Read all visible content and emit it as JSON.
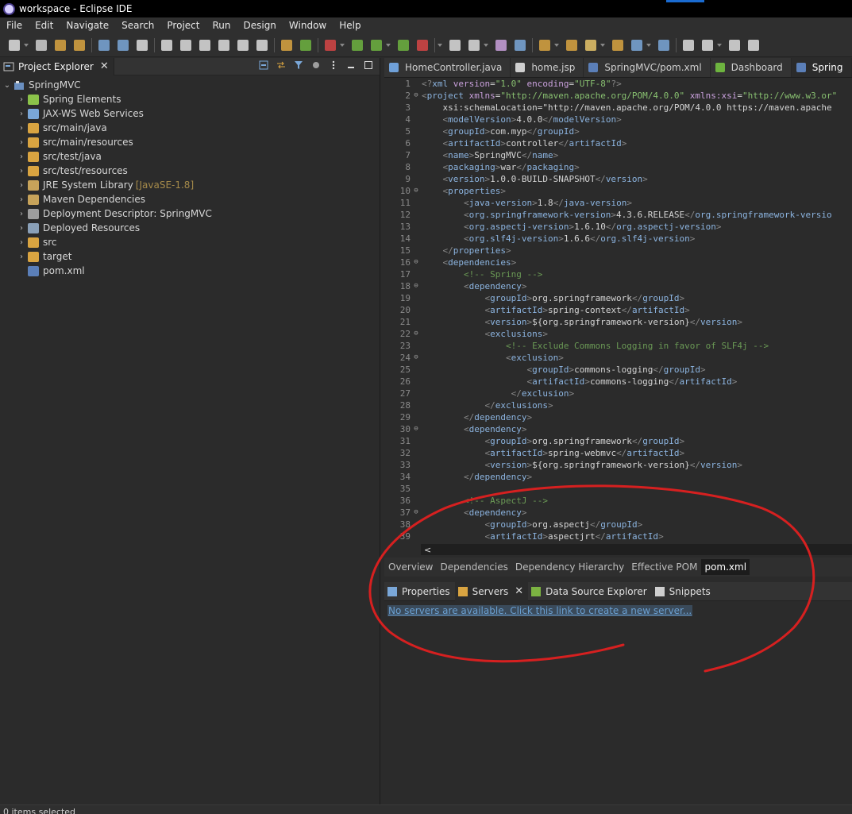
{
  "window": {
    "title": "workspace - Eclipse IDE"
  },
  "menu": [
    "File",
    "Edit",
    "Navigate",
    "Search",
    "Project",
    "Run",
    "Design",
    "Window",
    "Help"
  ],
  "project_explorer": {
    "title": "Project Explorer",
    "root": "SpringMVC",
    "items": [
      {
        "label": "Spring Elements",
        "icon": "spring-leaf-icon",
        "color": "#8bc34a"
      },
      {
        "label": "JAX-WS Web Services",
        "icon": "web-services-icon",
        "color": "#7aa7d8"
      },
      {
        "label": "src/main/java",
        "icon": "source-folder-icon",
        "color": "#d9a441"
      },
      {
        "label": "src/main/resources",
        "icon": "source-folder-icon",
        "color": "#d9a441"
      },
      {
        "label": "src/test/java",
        "icon": "source-folder-icon",
        "color": "#d9a441"
      },
      {
        "label": "src/test/resources",
        "icon": "source-folder-icon",
        "color": "#d9a441"
      },
      {
        "label": "JRE System Library",
        "decoration": "[JavaSE-1.8]",
        "icon": "library-icon",
        "color": "#c7a35a"
      },
      {
        "label": "Maven Dependencies",
        "icon": "library-icon",
        "color": "#c7a35a"
      },
      {
        "label": "Deployment Descriptor: SpringMVC",
        "icon": "descriptor-icon",
        "color": "#9e9e9e"
      },
      {
        "label": "Deployed Resources",
        "icon": "deployed-icon",
        "color": "#8aa0b8"
      },
      {
        "label": "src",
        "icon": "folder-icon",
        "color": "#d9a441"
      },
      {
        "label": "target",
        "icon": "folder-icon",
        "color": "#d9a441"
      },
      {
        "label": "pom.xml",
        "icon": "maven-file-icon",
        "color": "#5b7fb8",
        "leaf": true
      }
    ]
  },
  "editor": {
    "tabs": [
      {
        "label": "HomeController.java",
        "icon": "java-file-icon",
        "color": "#6fa0d8"
      },
      {
        "label": "home.jsp",
        "icon": "jsp-file-icon",
        "color": "#cfcfcf"
      },
      {
        "label": "SpringMVC/pom.xml",
        "icon": "maven-file-icon",
        "color": "#5b7fb8"
      },
      {
        "label": "Dashboard",
        "icon": "spring-dashboard-icon",
        "color": "#6db33f"
      },
      {
        "label": "Spring",
        "icon": "maven-file-icon",
        "color": "#5b7fb8",
        "active": true
      }
    ],
    "lines": [
      {
        "n": "1",
        "fold": "",
        "text": "<?xml version=\"1.0\" encoding=\"UTF-8\"?>"
      },
      {
        "n": "2",
        "fold": "⊖",
        "text": "<project xmlns=\"http://maven.apache.org/POM/4.0.0\" xmlns:xsi=\"http://www.w3.or"
      },
      {
        "n": "3",
        "fold": "",
        "text": "    xsi:schemaLocation=\"http://maven.apache.org/POM/4.0.0 https://maven.apache"
      },
      {
        "n": "4",
        "fold": "",
        "text": "    <modelVersion>4.0.0</modelVersion>"
      },
      {
        "n": "5",
        "fold": "",
        "text": "    <groupId>com.myp</groupId>"
      },
      {
        "n": "6",
        "fold": "",
        "text": "    <artifactId>controller</artifactId>"
      },
      {
        "n": "7",
        "fold": "",
        "text": "    <name>SpringMVC</name>"
      },
      {
        "n": "8",
        "fold": "",
        "text": "    <packaging>war</packaging>"
      },
      {
        "n": "9",
        "fold": "",
        "text": "    <version>1.0.0-BUILD-SNAPSHOT</version>"
      },
      {
        "n": "10",
        "fold": "⊖",
        "text": "    <properties>"
      },
      {
        "n": "11",
        "fold": "",
        "text": "        <java-version>1.8</java-version>"
      },
      {
        "n": "12",
        "fold": "",
        "text": "        <org.springframework-version>4.3.6.RELEASE</org.springframework-versio"
      },
      {
        "n": "13",
        "fold": "",
        "text": "        <org.aspectj-version>1.6.10</org.aspectj-version>"
      },
      {
        "n": "14",
        "fold": "",
        "text": "        <org.slf4j-version>1.6.6</org.slf4j-version>"
      },
      {
        "n": "15",
        "fold": "",
        "text": "    </properties>"
      },
      {
        "n": "16",
        "fold": "⊖",
        "text": "    <dependencies>"
      },
      {
        "n": "17",
        "fold": "",
        "text": "        <!-- Spring -->"
      },
      {
        "n": "18",
        "fold": "⊖",
        "text": "        <dependency>"
      },
      {
        "n": "19",
        "fold": "",
        "text": "            <groupId>org.springframework</groupId>"
      },
      {
        "n": "20",
        "fold": "",
        "text": "            <artifactId>spring-context</artifactId>"
      },
      {
        "n": "21",
        "fold": "",
        "text": "            <version>${org.springframework-version}</version>"
      },
      {
        "n": "22",
        "fold": "⊖",
        "text": "            <exclusions>"
      },
      {
        "n": "23",
        "fold": "",
        "text": "                <!-- Exclude Commons Logging in favor of SLF4j -->"
      },
      {
        "n": "24",
        "fold": "⊖",
        "text": "                <exclusion>"
      },
      {
        "n": "25",
        "fold": "",
        "text": "                    <groupId>commons-logging</groupId>"
      },
      {
        "n": "26",
        "fold": "",
        "text": "                    <artifactId>commons-logging</artifactId>"
      },
      {
        "n": "27",
        "fold": "",
        "text": "                 </exclusion>"
      },
      {
        "n": "28",
        "fold": "",
        "text": "            </exclusions>"
      },
      {
        "n": "29",
        "fold": "",
        "text": "        </dependency>"
      },
      {
        "n": "30",
        "fold": "⊖",
        "text": "        <dependency>"
      },
      {
        "n": "31",
        "fold": "",
        "text": "            <groupId>org.springframework</groupId>"
      },
      {
        "n": "32",
        "fold": "",
        "text": "            <artifactId>spring-webmvc</artifactId>"
      },
      {
        "n": "33",
        "fold": "",
        "text": "            <version>${org.springframework-version}</version>"
      },
      {
        "n": "34",
        "fold": "",
        "text": "        </dependency>"
      },
      {
        "n": "35",
        "fold": "",
        "text": ""
      },
      {
        "n": "36",
        "fold": "",
        "text": "        <!-- AspectJ -->"
      },
      {
        "n": "37",
        "fold": "⊖",
        "text": "        <dependency>"
      },
      {
        "n": "38",
        "fold": "",
        "text": "            <groupId>org.aspectj</groupId>"
      },
      {
        "n": "39",
        "fold": "",
        "text": "            <artifactId>aspectjrt</artifactId>"
      }
    ],
    "pom_tabs": [
      "Overview",
      "Dependencies",
      "Dependency Hierarchy",
      "Effective POM",
      "pom.xml"
    ],
    "active_pom_tab": "pom.xml"
  },
  "bottom_panel": {
    "tabs": [
      {
        "label": "Properties",
        "icon": "properties-icon",
        "color": "#7aa7d8"
      },
      {
        "label": "Servers",
        "icon": "servers-icon",
        "color": "#d9a441",
        "active": true,
        "closable": true
      },
      {
        "label": "Data Source Explorer",
        "icon": "data-source-icon",
        "color": "#7cb342"
      },
      {
        "label": "Snippets",
        "icon": "snippets-icon",
        "color": "#cfcfcf"
      }
    ],
    "server_link": "No servers are available. Click this link to create a new server..."
  },
  "status": {
    "text": "0 items selected"
  },
  "colors": {
    "xml_tag": "#8cb4e0",
    "xml_attr": "#c9a0dc",
    "xml_value": "#88c070",
    "xml_comment": "#6a9955",
    "annotation": "#d62020"
  }
}
